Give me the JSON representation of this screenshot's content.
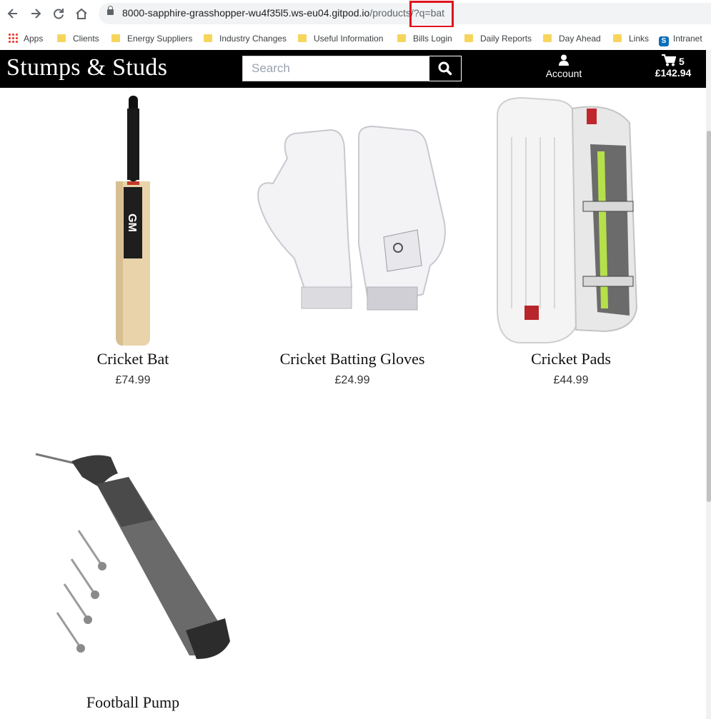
{
  "browser": {
    "url_host": "8000-sapphire-grasshopper-wu4f35l5.ws-eu04.gitpod.io",
    "url_path": "/products",
    "url_query": "/?q=bat",
    "bookmarks": [
      "Apps",
      "Clients",
      "Energy Suppliers",
      "Industry Changes",
      "Useful Information",
      "Bills Login",
      "Daily Reports",
      "Day Ahead",
      "Links",
      "Intranet"
    ]
  },
  "header": {
    "brand": "Stumps & Studs",
    "search_placeholder": "Search",
    "account_label": "Account",
    "cart_count": "5",
    "cart_total": "£142.94"
  },
  "products": [
    {
      "name": "Cricket Bat",
      "price": "£74.99"
    },
    {
      "name": "Cricket Batting Gloves",
      "price": "£24.99"
    },
    {
      "name": "Cricket Pads",
      "price": "£44.99"
    },
    {
      "name": "Football Pump",
      "price": ""
    }
  ],
  "colors": {
    "header_bg": "#000000",
    "highlight": "#e0141e"
  }
}
